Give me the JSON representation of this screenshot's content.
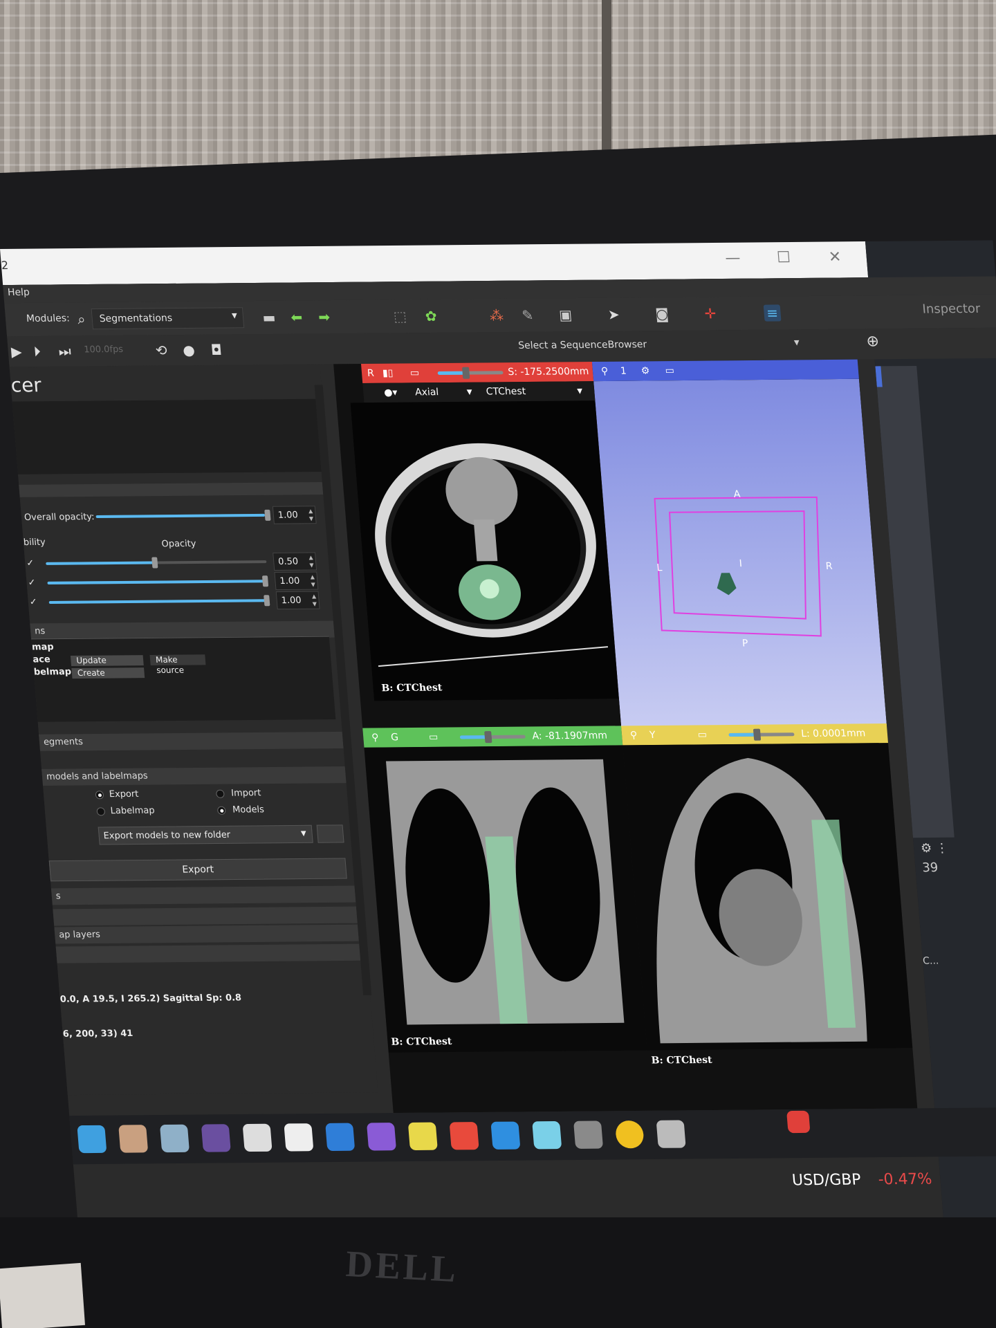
{
  "window": {
    "title_fragment": "2",
    "controls": [
      "—",
      "☐",
      "✕"
    ]
  },
  "menubar": {
    "help": "Help"
  },
  "toolbar": {
    "modules_label": "Modules:",
    "module_value": "Segmentations",
    "inspector": "Inspector"
  },
  "sequence": {
    "select_label": "Select a SequenceBrowser",
    "fps": "100.0fps"
  },
  "panel": {
    "title": "cer",
    "overall_opacity_label": "Overall opacity:",
    "overall_opacity_value": "1.00",
    "visibility_header": "bility",
    "opacity_header": "Opacity",
    "opacity_rows": [
      {
        "value": "0.50",
        "level": 0.5
      },
      {
        "value": "1.00",
        "level": 1.0
      },
      {
        "value": "1.00",
        "level": 1.0
      }
    ],
    "sections": {
      "sec1": "ns",
      "copy_segments": "egments",
      "export_import": "models and labelmaps",
      "segs_last": "s",
      "labelmap_layers": "ap layers"
    },
    "table": {
      "row1": "map",
      "row2": "ace",
      "row3": "belmap",
      "update": "Update",
      "make_source": "Make source",
      "create": "Create"
    },
    "radios": {
      "export": "Export",
      "import": "Import",
      "labelmap": "Labelmap",
      "models": "Models"
    },
    "export_combo": "Export models to new folder",
    "export_button": "Export",
    "status1": "0.0, A 19.5, I 265.2)  Sagittal Sp: 0.8",
    "status2": "6, 200,  33) 41"
  },
  "views": {
    "red": {
      "letter": "R",
      "offset": "S: -175.2500mm",
      "orientation": "Axial",
      "volume": "CTChest",
      "label": "B: CTChest"
    },
    "threed": {
      "index": "1",
      "A": "A",
      "L": "L",
      "R": "R",
      "I": "I",
      "P": "P"
    },
    "green": {
      "letter": "G",
      "offset": "A: -81.1907mm",
      "label": "B: CTChest"
    },
    "yellow": {
      "letter": "Y",
      "offset": "L: 0.0001mm",
      "label": "B: CTChest"
    }
  },
  "right_strip": {
    "count": "39",
    "truncated": "C..."
  },
  "ticker": {
    "pair": "USD/GBP",
    "change": "-0.47%"
  },
  "colors": {
    "red_bar": "#e0403a",
    "green_bar": "#5ec25a",
    "yellow_bar": "#e8d155",
    "blue_bar": "#4a5fd8",
    "threed_bg": "#8e9ae6",
    "accent": "#5ab9f0",
    "segment": "#8fd8a8",
    "ticker_neg": "#e84a4a"
  }
}
